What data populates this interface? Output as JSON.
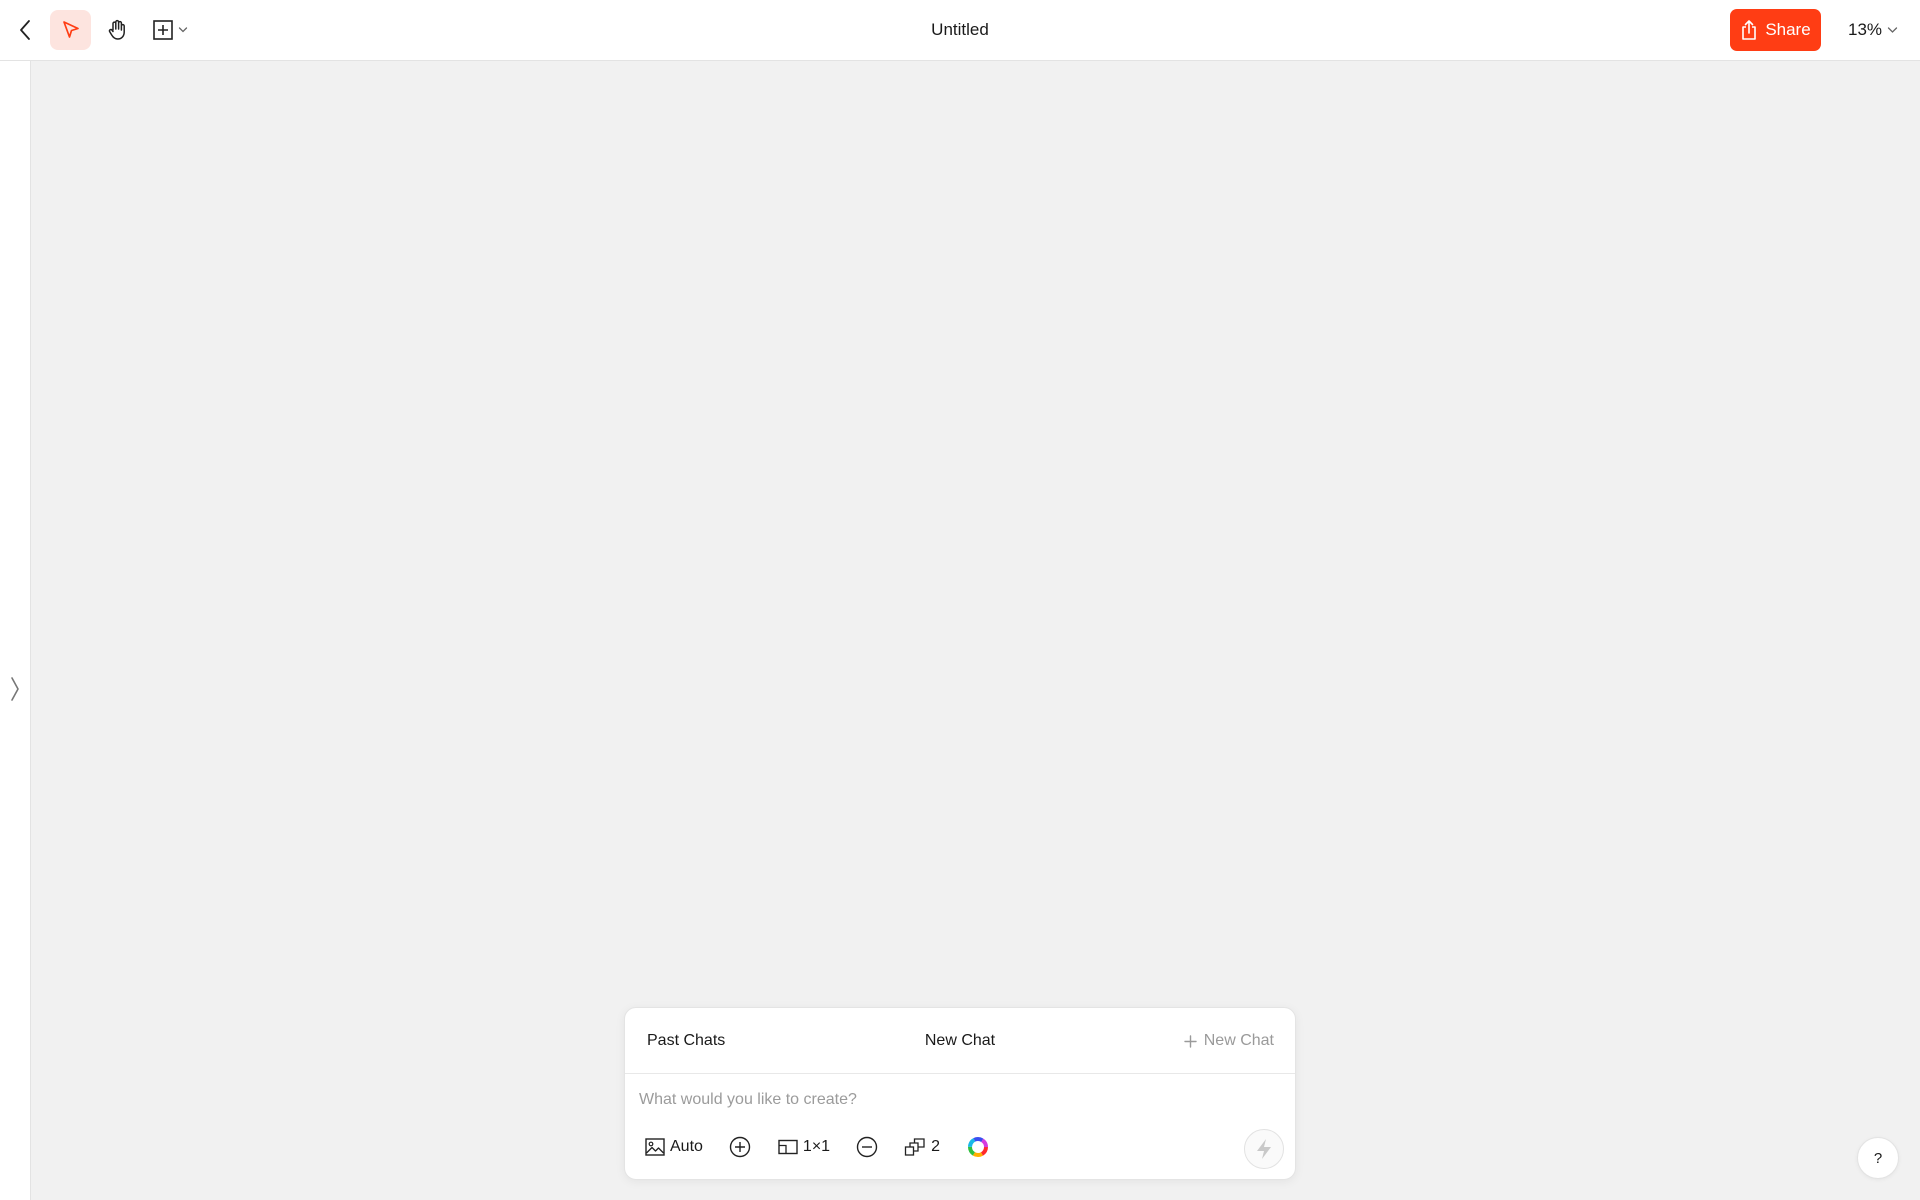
{
  "colors": {
    "accent": "#ff3d14",
    "accent_soft": "#fde4df",
    "canvas_bg": "#f1f1f1",
    "panel_bg": "#ffffff",
    "muted_text": "#9a9a9a"
  },
  "toolbar": {
    "back_icon": "chevron-left-icon",
    "tools": [
      {
        "name": "select",
        "icon": "cursor-arrow-icon",
        "active": true
      },
      {
        "name": "hand",
        "icon": "hand-icon",
        "active": false
      },
      {
        "name": "frame",
        "icon": "frame-plus-icon",
        "has_dropdown": true,
        "active": false
      }
    ],
    "title": "Untitled",
    "share_label": "Share",
    "share_icon": "share-upload-icon",
    "zoom_label": "13%"
  },
  "sidebar": {
    "toggle_icon": "angle-right-icon"
  },
  "chat": {
    "past_chats_label": "Past Chats",
    "title": "New Chat",
    "new_chat_label": "New Chat",
    "prompt_placeholder": "What would you like to create?",
    "tools": {
      "model_label": "Auto",
      "model_icon": "image-icon",
      "add_icon": "plus-circle-icon",
      "aspect_label": "1×1",
      "aspect_icon": "aspect-ratio-icon",
      "remove_icon": "minus-circle-icon",
      "count_label": "2",
      "count_icon": "stack-icon",
      "color_icon": "color-wheel-icon"
    },
    "send_icon": "lightning-icon"
  },
  "help_label": "?"
}
